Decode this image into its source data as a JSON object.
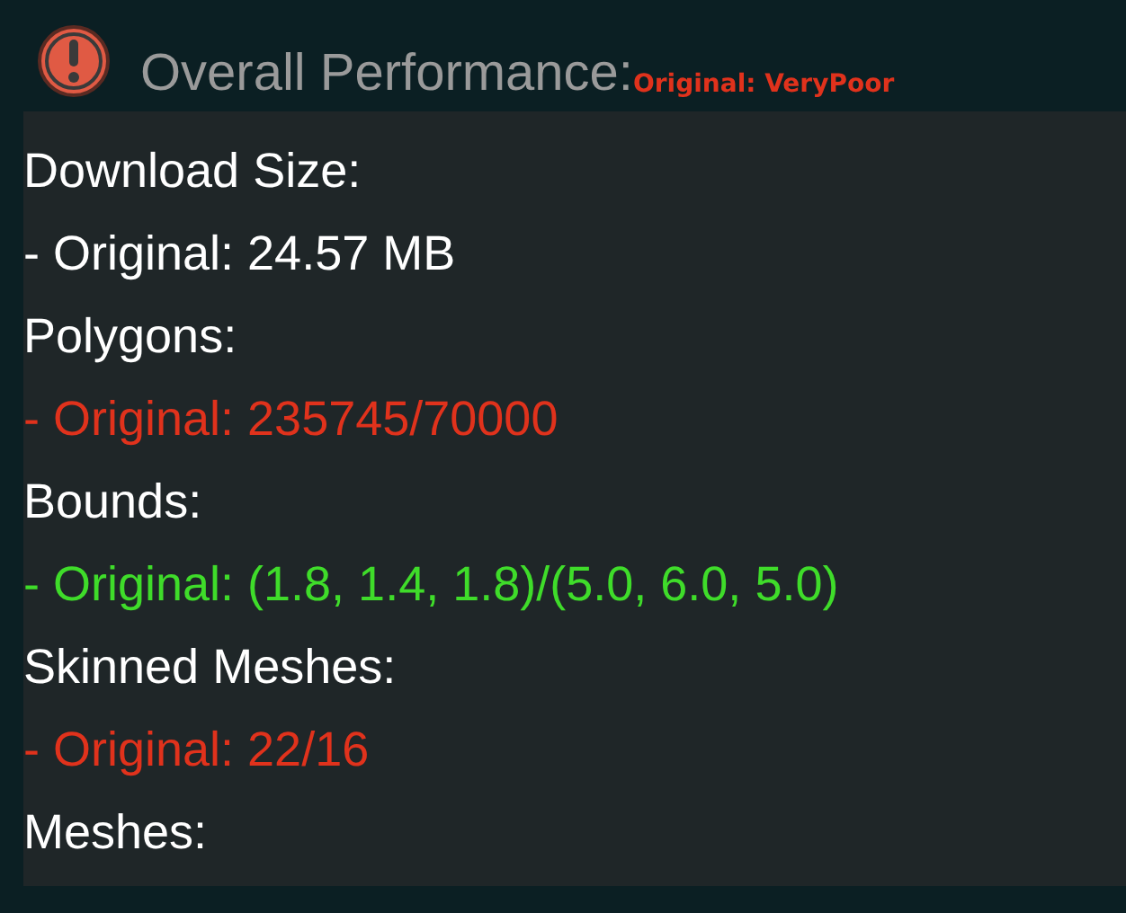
{
  "header": {
    "title": "Overall Performance:",
    "rating": "Original: VeryPoor",
    "color": "#e0321c"
  },
  "stats": [
    {
      "label": "Download Size:",
      "value": "- Original: 24.57 MB",
      "color": "#ffffff"
    },
    {
      "label": "Polygons:",
      "value": "- Original: 235745/70000",
      "color": "#e0321c"
    },
    {
      "label": "Bounds:",
      "value": "- Original: (1.8, 1.4, 1.8)/(5.0, 6.0, 5.0)",
      "color": "#3fdc2a"
    },
    {
      "label": "Skinned Meshes:",
      "value": "- Original: 22/16",
      "color": "#e0321c"
    },
    {
      "label": "Meshes:"
    }
  ]
}
